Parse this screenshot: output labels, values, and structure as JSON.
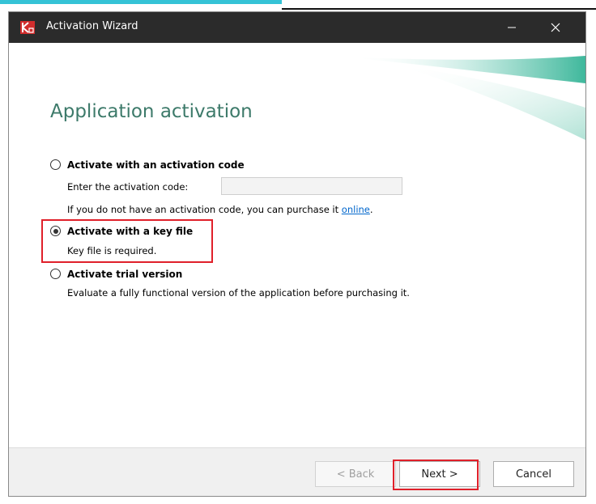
{
  "window": {
    "title": "Activation Wizard"
  },
  "page": {
    "title": "Application activation"
  },
  "options": {
    "activation_code": {
      "label": "Activate with an activation code",
      "field_label": "Enter the activation code:",
      "field_value": "",
      "purchase_text": "If you do not have an activation code, you can purchase it ",
      "purchase_link": "online",
      "purchase_suffix": ".",
      "selected": false
    },
    "key_file": {
      "label": "Activate with a key file",
      "description": "Key file is required.",
      "selected": true
    },
    "trial": {
      "label": "Activate trial version",
      "description": "Evaluate a fully functional version of the application before purchasing it.",
      "selected": false
    }
  },
  "buttons": {
    "back": "< Back",
    "next": "Next >",
    "cancel": "Cancel"
  },
  "icons": {
    "app": "kaspersky-logo-icon",
    "minimize": "minimize-icon",
    "close": "close-icon"
  },
  "colors": {
    "titlebar": "#2b2b2b",
    "title_text": "#3d7a6a",
    "link": "#0066cc",
    "highlight": "#e0202a",
    "accent_teal": "#1fa58c"
  }
}
